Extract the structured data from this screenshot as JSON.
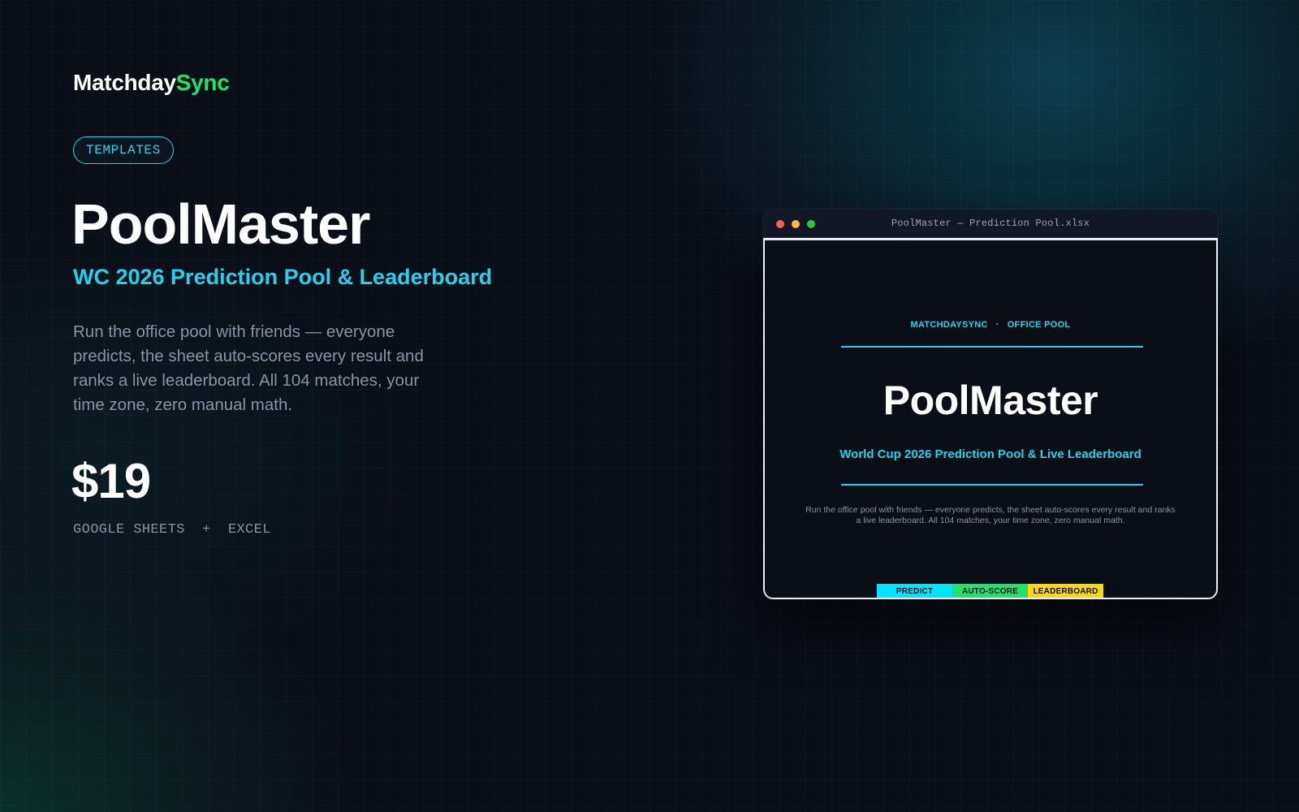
{
  "brand": {
    "name_primary": "Matchday",
    "name_accent": "Sync",
    "accent_color": "#1fe36b"
  },
  "hero": {
    "category_pill": "TEMPLATES",
    "title": "PoolMaster",
    "subtitle": "WC 2026 Prediction Pool & Leaderboard",
    "description": "Run the office pool with friends — everyone predicts, the sheet auto-scores every result and ranks a live leaderboard. All 104 matches, your time zone, zero manual math.",
    "price": "$19",
    "platforms": "GOOGLE SHEETS  +  EXCEL"
  },
  "preview_window": {
    "title": "PoolMaster — Prediction Pool.xlsx",
    "traffic_lights": [
      {
        "name": "close",
        "color": "#ff5f57"
      },
      {
        "name": "minimize",
        "color": "#febc2e"
      },
      {
        "name": "maximize",
        "color": "#28c840"
      }
    ],
    "document": {
      "kicker_left": "MATCHDAYSYNC",
      "kicker_separator": "·",
      "kicker_right": "OFFICE POOL",
      "title": "PoolMaster",
      "subtitle": "World Cup 2026 Prediction Pool & Live Leaderboard",
      "description": "Run the office pool with friends — everyone predicts, the sheet auto-scores every result and ranks a live leaderboard. All 104 matches, your time zone, zero manual math.",
      "tags": [
        {
          "label": "PREDICT",
          "color": "#00e5ff"
        },
        {
          "label": "AUTO-SCORE",
          "color": "#1fe36b"
        },
        {
          "label": "LEADERBOARD",
          "color": "#ffd60a"
        }
      ]
    }
  },
  "colors": {
    "background": "#0a0e17",
    "cyan_accent": "#22d3ee",
    "muted_text": "#8a93a4"
  }
}
